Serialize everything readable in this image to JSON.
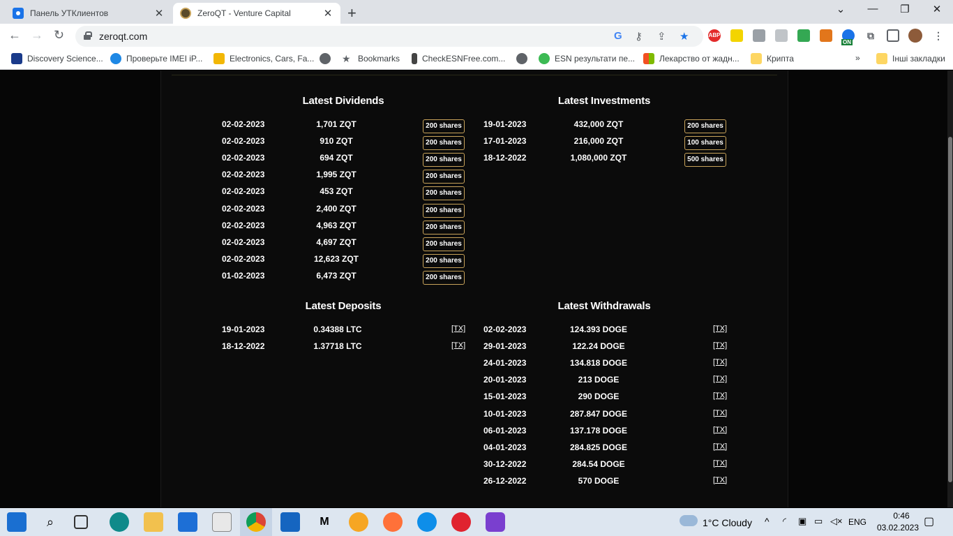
{
  "browser": {
    "tabs": [
      {
        "title": "Панель УТКлиентов"
      },
      {
        "title": "ZeroQT - Venture Capital"
      }
    ],
    "url": "zeroqt.com",
    "bookmarks": [
      "Discovery Science...",
      "Проверьте IMEI iP...",
      "Electronics, Cars, Fa...",
      "Bookmarks",
      "CheckESNFree.com...",
      "ESN результати пе...",
      "Лекарство от жадн...",
      "Крипта",
      "Інші закладки"
    ],
    "ext_badge": "ON",
    "abp": "ABP"
  },
  "dividends": {
    "title": "Latest Dividends",
    "rows": [
      {
        "date": "02-02-2023",
        "amount": "1,701 ZQT",
        "shares": "200 shares"
      },
      {
        "date": "02-02-2023",
        "amount": "910 ZQT",
        "shares": "200 shares"
      },
      {
        "date": "02-02-2023",
        "amount": "694 ZQT",
        "shares": "200 shares"
      },
      {
        "date": "02-02-2023",
        "amount": "1,995 ZQT",
        "shares": "200 shares"
      },
      {
        "date": "02-02-2023",
        "amount": "453 ZQT",
        "shares": "200 shares"
      },
      {
        "date": "02-02-2023",
        "amount": "2,400 ZQT",
        "shares": "200 shares"
      },
      {
        "date": "02-02-2023",
        "amount": "4,963 ZQT",
        "shares": "200 shares"
      },
      {
        "date": "02-02-2023",
        "amount": "4,697 ZQT",
        "shares": "200 shares"
      },
      {
        "date": "02-02-2023",
        "amount": "12,623 ZQT",
        "shares": "200 shares"
      },
      {
        "date": "01-02-2023",
        "amount": "6,473 ZQT",
        "shares": "200 shares"
      }
    ]
  },
  "investments": {
    "title": "Latest Investments",
    "rows": [
      {
        "date": "19-01-2023",
        "amount": "432,000 ZQT",
        "shares": "200 shares"
      },
      {
        "date": "17-01-2023",
        "amount": "216,000 ZQT",
        "shares": "100 shares"
      },
      {
        "date": "18-12-2022",
        "amount": "1,080,000 ZQT",
        "shares": "500 shares"
      }
    ]
  },
  "deposits": {
    "title": "Latest Deposits",
    "rows": [
      {
        "date": "19-01-2023",
        "amount": "0.34388 LTC",
        "link": "[TX]"
      },
      {
        "date": "18-12-2022",
        "amount": "1.37718 LTC",
        "link": "[TX]"
      }
    ]
  },
  "withdrawals": {
    "title": "Latest Withdrawals",
    "rows": [
      {
        "date": "02-02-2023",
        "amount": "124.393 DOGE",
        "link": "[TX]"
      },
      {
        "date": "29-01-2023",
        "amount": "122.24 DOGE",
        "link": "[TX]"
      },
      {
        "date": "24-01-2023",
        "amount": "134.818 DOGE",
        "link": "[TX]"
      },
      {
        "date": "20-01-2023",
        "amount": "213 DOGE",
        "link": "[TX]"
      },
      {
        "date": "15-01-2023",
        "amount": "290 DOGE",
        "link": "[TX]"
      },
      {
        "date": "10-01-2023",
        "amount": "287.847 DOGE",
        "link": "[TX]"
      },
      {
        "date": "06-01-2023",
        "amount": "137.178 DOGE",
        "link": "[TX]"
      },
      {
        "date": "04-01-2023",
        "amount": "284.825 DOGE",
        "link": "[TX]"
      },
      {
        "date": "30-12-2022",
        "amount": "284.54 DOGE",
        "link": "[TX]"
      },
      {
        "date": "26-12-2022",
        "amount": "570 DOGE",
        "link": "[TX]"
      }
    ]
  },
  "taskbar": {
    "weather": "1°C  Cloudy",
    "language": "ENG",
    "time": "0:46",
    "date": "03.02.2023",
    "mail_app": "M"
  },
  "colors": {
    "accent_gold": "#c8a35a",
    "page_bg": "#060606",
    "chrome_active_blue": "#1a73e8"
  }
}
